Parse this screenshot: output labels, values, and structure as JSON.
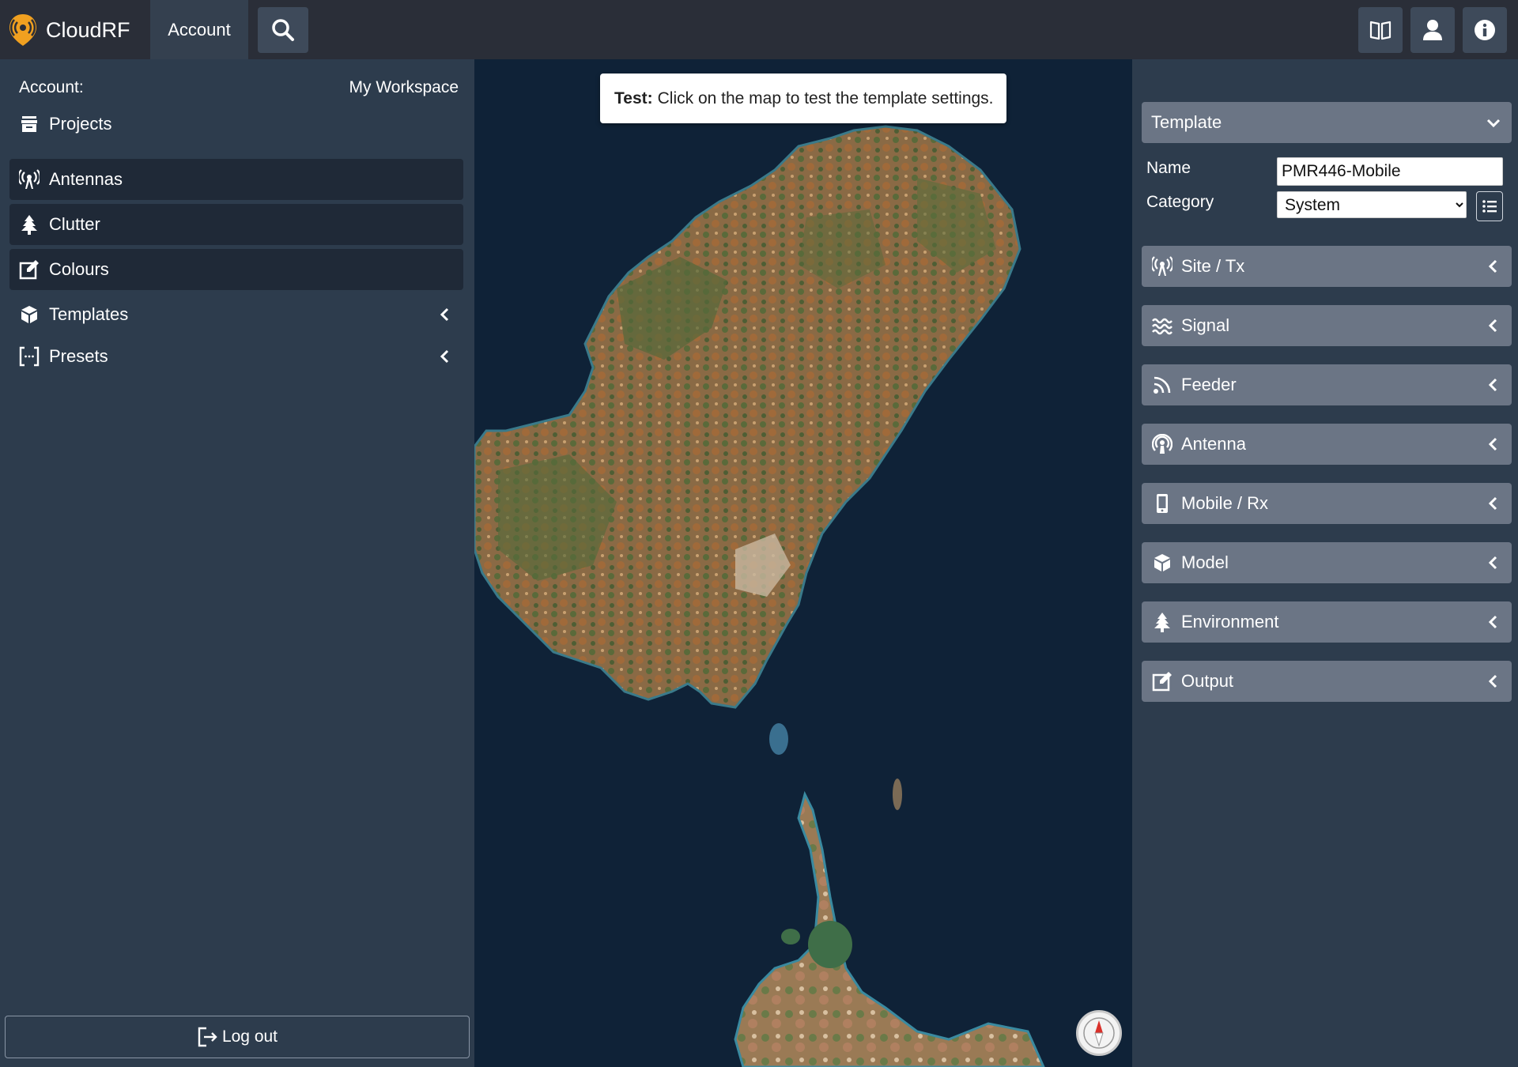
{
  "header": {
    "brand": "CloudRF",
    "nav_account": "Account",
    "icons": [
      "search-icon",
      "book-icon",
      "user-icon",
      "info-icon"
    ]
  },
  "sidebar": {
    "account_label": "Account:",
    "workspace": "My Workspace",
    "items": [
      {
        "label": "Projects",
        "icon": "archive-icon"
      },
      {
        "label": "Antennas",
        "icon": "broadcast-tower-icon"
      },
      {
        "label": "Clutter",
        "icon": "tree-icon"
      },
      {
        "label": "Colours",
        "icon": "edit-square-icon"
      },
      {
        "label": "Templates",
        "icon": "cube-icon"
      },
      {
        "label": "Presets",
        "icon": "brackets-icon"
      }
    ],
    "logout": "Log out"
  },
  "map": {
    "toast_bold": "Test:",
    "toast_text": "Click on the map to test the template settings."
  },
  "panel": {
    "template_header": "Template",
    "name_label": "Name",
    "name_value": "PMR446-Mobile",
    "category_label": "Category",
    "category_value": "System",
    "sections": [
      {
        "label": "Site / Tx",
        "icon": "broadcast-tower-icon"
      },
      {
        "label": "Signal",
        "icon": "water-waves-icon"
      },
      {
        "label": "Feeder",
        "icon": "rss-icon"
      },
      {
        "label": "Antenna",
        "icon": "podcast-icon"
      },
      {
        "label": "Mobile / Rx",
        "icon": "mobile-icon"
      },
      {
        "label": "Model",
        "icon": "cube-icon"
      },
      {
        "label": "Environment",
        "icon": "tree-icon"
      },
      {
        "label": "Output",
        "icon": "edit-square-icon"
      }
    ]
  },
  "colors": {
    "topbar": "#2a2e38",
    "sidebar": "#2d3c4d",
    "sea": "#0f2237",
    "accordion": "#6b7585",
    "brand_orange": "#f0a020"
  }
}
